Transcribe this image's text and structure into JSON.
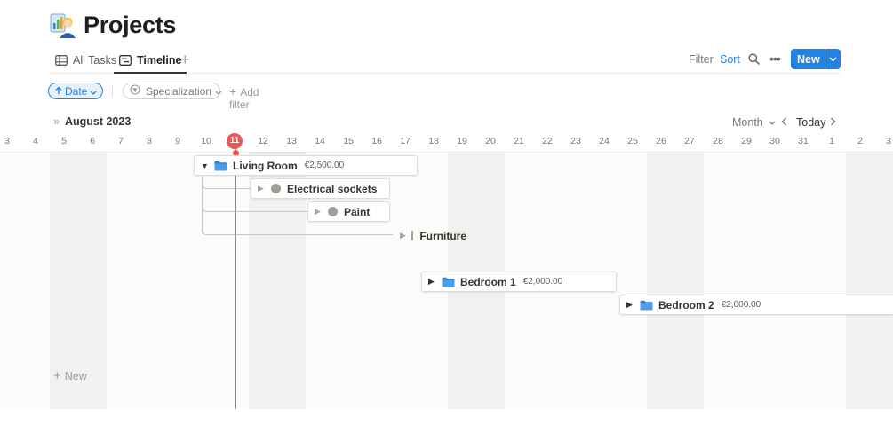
{
  "page": {
    "title": "Projects",
    "icon": "person-with-chart-icon"
  },
  "tabs": [
    {
      "label": "All Tasks",
      "icon": "table-icon",
      "active": false
    },
    {
      "label": "Timeline",
      "icon": "timeline-icon",
      "active": true
    }
  ],
  "toolbar": {
    "filter_label": "Filter",
    "sort_label": "Sort",
    "new_label": "New",
    "accent": "#2383e2"
  },
  "filters": {
    "date_label": "Date",
    "specialization_label": "Specialization",
    "add_filter_label": "Add filter"
  },
  "timeline": {
    "month_label": "August 2023",
    "view_label": "Month",
    "today_label": "Today",
    "today_date": "11",
    "days": [
      "3",
      "4",
      "5",
      "6",
      "7",
      "8",
      "9",
      "10",
      "11",
      "12",
      "13",
      "14",
      "15",
      "16",
      "17",
      "18",
      "19",
      "20",
      "21",
      "22",
      "23",
      "24",
      "25",
      "26",
      "27",
      "28",
      "29",
      "30",
      "31",
      "1",
      "2",
      "3"
    ],
    "new_row_label": "New",
    "today_color": "#eb5757",
    "items": [
      {
        "name": "Living Room",
        "price": "€2,500.00",
        "type": "folder",
        "expanded": true
      },
      {
        "name": "Electrical sockets",
        "type": "task",
        "parent": "Living Room"
      },
      {
        "name": "Paint",
        "type": "task",
        "parent": "Living Room"
      },
      {
        "name": "Furniture",
        "type": "task",
        "parent": "Living Room"
      },
      {
        "name": "Bedroom 1",
        "price": "€2,000.00",
        "type": "folder",
        "expanded": false
      },
      {
        "name": "Bedroom 2",
        "price": "€2,000.00",
        "type": "folder",
        "expanded": false
      }
    ]
  }
}
